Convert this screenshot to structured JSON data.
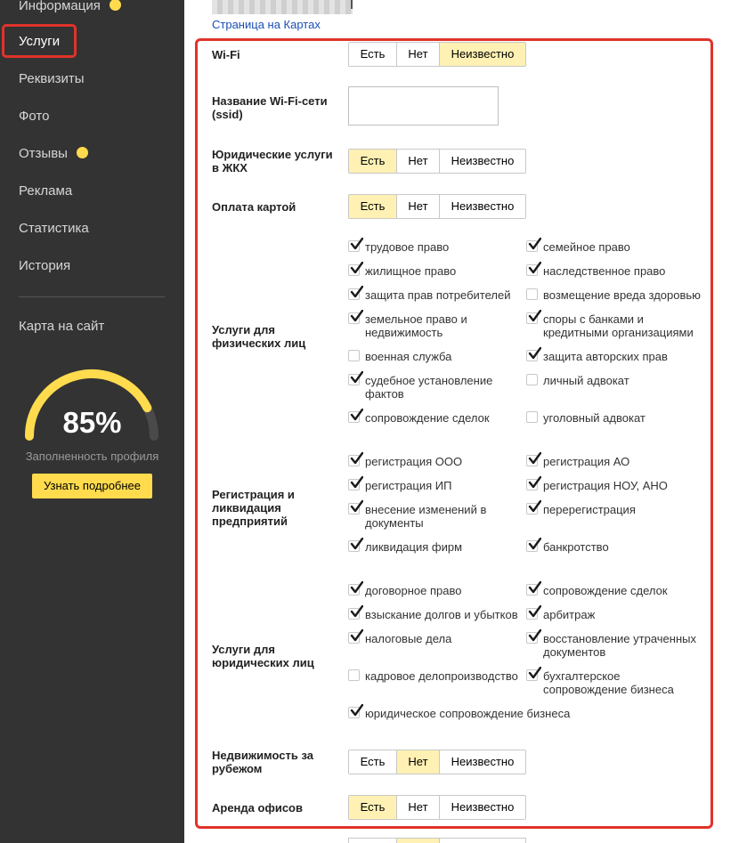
{
  "sidebar": {
    "items": [
      {
        "label": "Информация",
        "badge": true
      },
      {
        "label": "Услуги",
        "active": true
      },
      {
        "label": "Реквизиты"
      },
      {
        "label": "Фото"
      },
      {
        "label": "Отзывы",
        "badge": true
      },
      {
        "label": "Реклама"
      },
      {
        "label": "Статистика"
      },
      {
        "label": "История"
      }
    ],
    "map_link": "Карта на сайт",
    "profile": {
      "percent_label": "85%",
      "fill_fraction": 0.85,
      "caption": "Заполненность профиля",
      "button": "Узнать подробнее"
    }
  },
  "header": {
    "maps_link": "Страница на Картах"
  },
  "fields": {
    "wifi": {
      "label": "Wi-Fi",
      "options": [
        "Есть",
        "Нет",
        "Неизвестно"
      ],
      "selected": "Неизвестно"
    },
    "ssid": {
      "label": "Название Wi-Fi-сети (ssid)",
      "value": ""
    },
    "housing": {
      "label": "Юридические услуги в ЖКХ",
      "options": [
        "Есть",
        "Нет",
        "Неизвестно"
      ],
      "selected": "Есть"
    },
    "card": {
      "label": "Оплата картой",
      "options": [
        "Есть",
        "Нет",
        "Неизвестно"
      ],
      "selected": "Есть"
    },
    "individuals": {
      "label": "Услуги для физических лиц",
      "items": [
        {
          "text": "трудовое право",
          "checked": true
        },
        {
          "text": "семейное право",
          "checked": true
        },
        {
          "text": "жилищное право",
          "checked": true
        },
        {
          "text": "наследственное право",
          "checked": true
        },
        {
          "text": "защита прав потребителей",
          "checked": true
        },
        {
          "text": "возмещение вреда здоровью",
          "checked": false
        },
        {
          "text": "земельное право и недвижимость",
          "checked": true
        },
        {
          "text": "споры с банками и кредитными организациями",
          "checked": true
        },
        {
          "text": "военная служба",
          "checked": false
        },
        {
          "text": "защита авторских прав",
          "checked": true
        },
        {
          "text": "судебное установление фактов",
          "checked": true
        },
        {
          "text": "личный адвокат",
          "checked": false
        },
        {
          "text": "сопровождение сделок",
          "checked": true
        },
        {
          "text": "уголовный адвокат",
          "checked": false
        }
      ]
    },
    "registration": {
      "label": "Регистрация и ликвидация предприятий",
      "items": [
        {
          "text": "регистрация ООО",
          "checked": true
        },
        {
          "text": "регистрация АО",
          "checked": true
        },
        {
          "text": "регистрация ИП",
          "checked": true
        },
        {
          "text": "регистрация НОУ, АНО",
          "checked": true
        },
        {
          "text": "внесение изменений в документы",
          "checked": true
        },
        {
          "text": "перерегистрация",
          "checked": true
        },
        {
          "text": "ликвидация фирм",
          "checked": true
        },
        {
          "text": "банкротство",
          "checked": true
        }
      ]
    },
    "legal_entities": {
      "label": "Услуги для юридических лиц",
      "items": [
        {
          "text": "договорное право",
          "checked": true
        },
        {
          "text": "сопровождение сделок",
          "checked": true
        },
        {
          "text": "взыскание долгов и убытков",
          "checked": true
        },
        {
          "text": "арбитраж",
          "checked": true
        },
        {
          "text": "налоговые дела",
          "checked": true
        },
        {
          "text": "восстановление утраченных документов",
          "checked": true
        },
        {
          "text": "кадровое делопроизводство",
          "checked": false
        },
        {
          "text": "бухгалтерское сопровождение бизнеса",
          "checked": true
        },
        {
          "text": "юридическое сопровождение бизнеса",
          "checked": true
        }
      ]
    },
    "realty_abroad": {
      "label": "Недвижимость за рубежом",
      "options": [
        "Есть",
        "Нет",
        "Неизвестно"
      ],
      "selected": "Нет"
    },
    "office_rent": {
      "label": "Аренда офисов",
      "options": [
        "Есть",
        "Нет",
        "Неизвестно"
      ],
      "selected": "Есть"
    }
  },
  "colors": {
    "sidebar_bg": "#333333",
    "accent_yellow": "#ffdb4d",
    "selected_option": "#fff0b3",
    "highlight_red": "#e0332a",
    "link_blue": "#1a4fb8"
  }
}
